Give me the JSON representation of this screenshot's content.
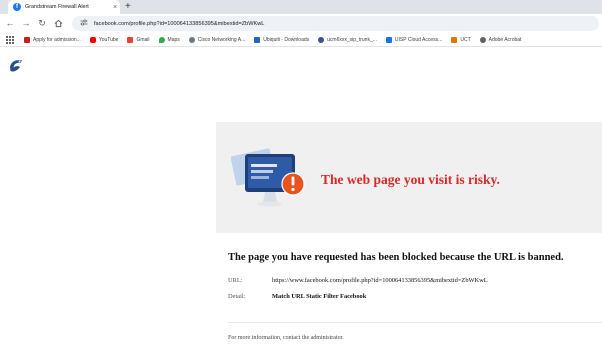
{
  "browser": {
    "tab": {
      "title": "Grandstream Firewall Alert",
      "favicon": "facebook-icon",
      "close_glyph": "×"
    },
    "new_tab_glyph": "+",
    "address": {
      "url": "facebook.com/profile.php?id=100064133856395&mibextid=ZbWKwL"
    },
    "bookmarks": [
      {
        "label": "Apply for admission...",
        "icon": "bookmark-icon",
        "color": "#c5221f"
      },
      {
        "label": "YouTube",
        "icon": "youtube-icon",
        "color": "#ff0000"
      },
      {
        "label": "Gmail",
        "icon": "gmail-icon",
        "color": "#ea4335"
      },
      {
        "label": "Maps",
        "icon": "maps-icon",
        "color": "#34a853"
      },
      {
        "label": "Cisco Networking A...",
        "icon": "cisco-icon",
        "color": "#6f7a86"
      },
      {
        "label": "Ubiquiti - Downloads",
        "icon": "ubiquiti-icon",
        "color": "#1f66c1"
      },
      {
        "label": "ucm6xxx_sip_trunk_...",
        "icon": "globe-icon",
        "color": "#3c4f8f"
      },
      {
        "label": "UISP Cloud Access...",
        "icon": "uisp-icon",
        "color": "#1a73e8"
      },
      {
        "label": "UCT",
        "icon": "uct-icon",
        "color": "#e37400"
      },
      {
        "label": "Adobe Acrobat",
        "icon": "globe-icon",
        "color": "#5f6368"
      }
    ]
  },
  "alert": {
    "headline": "The web page you visit is risky.",
    "blocked_message": "The page you have requested has been blocked because the URL is banned.",
    "url_label": "URL:",
    "url_value": "https://www.facebook.com/profile.php?id=100064133856395&mibextid=ZbWKwL",
    "detail_label": "Detail:",
    "detail_value": "Match URL Static Filter Facebook",
    "footer": "For more information, contact the administrator."
  },
  "colors": {
    "headline": "#d62a2a",
    "banner_bg": "#f0f0f0",
    "warning_badge": "#e8541b",
    "monitor_screen": "#1f3f78",
    "brand_logo": "#2a4f8a"
  }
}
